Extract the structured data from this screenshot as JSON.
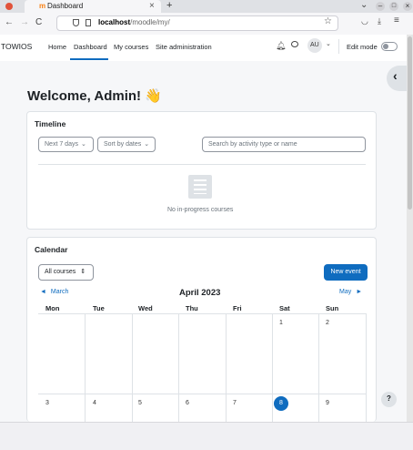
{
  "browser": {
    "tab_title": "Dashboard",
    "tab_close": "×",
    "new_tab": "+",
    "url_host": "localhost",
    "url_path": "/moodle/my/",
    "back": "←",
    "forward": "→",
    "reload": "C",
    "window_chevron": "⌄",
    "window_min": "–",
    "window_max": "□",
    "window_close": "×"
  },
  "navbar": {
    "brand": "TOWIOS",
    "links": [
      "Home",
      "Dashboard",
      "My courses",
      "Site administration"
    ],
    "active_link": "Dashboard",
    "avatar_initials": "AU",
    "edit_mode_label": "Edit mode"
  },
  "welcome": {
    "title": "Welcome, Admin! 👋"
  },
  "timeline": {
    "title": "Timeline",
    "filter_days": "Next 7 days",
    "sort_by": "Sort by dates",
    "search_placeholder": "Search by activity type or name",
    "empty_text": "No in-progress courses"
  },
  "calendar": {
    "title": "Calendar",
    "course_select": "All courses",
    "new_event_label": "New event",
    "prev_month": "March",
    "next_month": "May",
    "month_title": "April 2023",
    "day_headers": [
      "Mon",
      "Tue",
      "Wed",
      "Thu",
      "Fri",
      "Sat",
      "Sun"
    ],
    "week1": [
      "",
      "",
      "",
      "",
      "",
      "1",
      "2"
    ],
    "week2": [
      "3",
      "4",
      "5",
      "6",
      "7",
      "8",
      "9"
    ],
    "today": "8",
    "today_color": "#0f6cbf"
  },
  "help_button": "?",
  "drawer_toggle": "‹"
}
